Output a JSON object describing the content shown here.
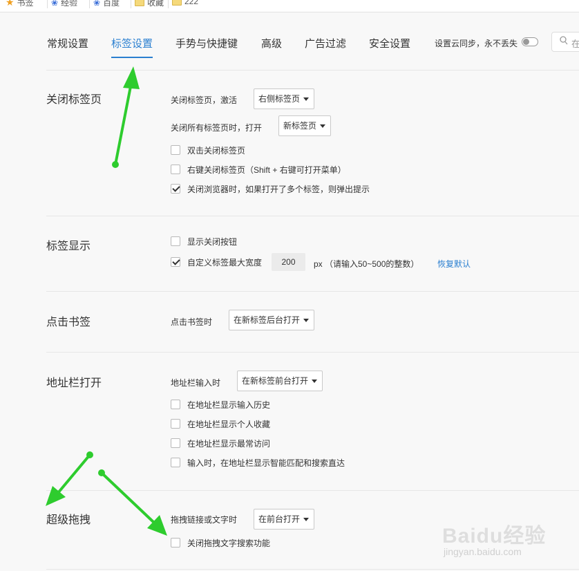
{
  "bookmarks": [
    {
      "label": "书签",
      "icon": "star-icon"
    },
    {
      "label": "经验",
      "icon": "paw-icon"
    },
    {
      "label": "百度",
      "icon": "paw-icon"
    },
    {
      "label": "收藏",
      "icon": "folder-icon"
    },
    {
      "label": "222",
      "icon": "folder-icon"
    }
  ],
  "tabs": [
    {
      "label": "常规设置",
      "active": false
    },
    {
      "label": "标签设置",
      "active": true
    },
    {
      "label": "手势与快捷键",
      "active": false
    },
    {
      "label": "高级",
      "active": false
    },
    {
      "label": "广告过滤",
      "active": false
    },
    {
      "label": "安全设置",
      "active": false
    }
  ],
  "sync": {
    "label": "设置云同步，永不丢失",
    "enabled": false
  },
  "search": {
    "value": "在"
  },
  "sections": {
    "close_tab": {
      "title": "关闭标签页",
      "activate_label": "关闭标签页，激活",
      "activate_value": "右侧标签页",
      "close_all_label": "关闭所有标签页时，打开",
      "close_all_value": "新标签页",
      "options": [
        {
          "label": "双击关闭标签页",
          "checked": false
        },
        {
          "label": "右键关闭标签页（Shift + 右键可打开菜单）",
          "checked": false
        },
        {
          "label": "关闭浏览器时，如果打开了多个标签，则弹出提示",
          "checked": true
        }
      ]
    },
    "tab_display": {
      "title": "标签显示",
      "options": [
        {
          "label": "显示关闭按钮",
          "checked": false
        },
        {
          "label": "自定义标签最大宽度",
          "checked": true
        }
      ],
      "width_value": "200",
      "width_unit": "px （请输入50~500的整数）",
      "restore_default": "恢复默认"
    },
    "bookmark_click": {
      "title": "点击书签",
      "label": "点击书签时",
      "value": "在新标签后台打开"
    },
    "address_bar": {
      "title": "地址栏打开",
      "label": "地址栏输入时",
      "value": "在新标签前台打开",
      "options": [
        {
          "label": "在地址栏显示输入历史",
          "checked": false
        },
        {
          "label": "在地址栏显示个人收藏",
          "checked": false
        },
        {
          "label": "在地址栏显示最常访问",
          "checked": false
        },
        {
          "label": "输入时，在地址栏显示智能匹配和搜索直达",
          "checked": false
        }
      ]
    },
    "super_drag": {
      "title": "超级拖拽",
      "label": "拖拽链接或文字时",
      "value": "在前台打开",
      "options": [
        {
          "label": "关闭拖拽文字搜索功能",
          "checked": false
        }
      ]
    }
  },
  "watermark": {
    "brand": "Baidu经验",
    "url": "jingyan.baidu.com"
  },
  "colors": {
    "accent": "#2a7fd0",
    "annotation_arrow": "#2ecc2e"
  }
}
